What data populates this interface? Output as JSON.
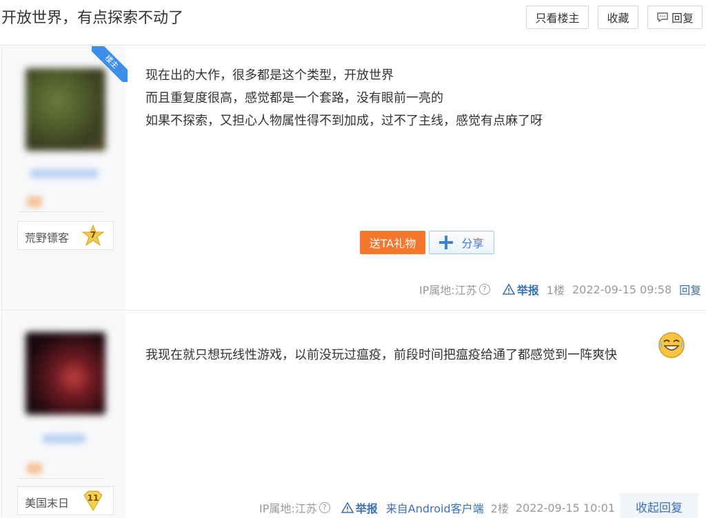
{
  "header": {
    "title": "开放世界，有点探索不动了",
    "btn_only_op": "只看楼主",
    "btn_favorite": "收藏",
    "btn_reply": "回复"
  },
  "posts": [
    {
      "author_level_name": "荒野镖客",
      "level": "7",
      "op_badge": "楼主",
      "lines": [
        "现在出的大作，很多都是这个类型，开放世界",
        "而且重复度很高，感觉都是一个套路，没有眼前一亮的",
        "如果不探索，又担心人物属性得不到加成，过不了主线，感觉有点麻了呀"
      ],
      "gift_label": "送TA礼物",
      "share_label": "分享",
      "ip": "IP属地:江苏",
      "help": "?",
      "report": "举报",
      "floor": "1楼",
      "time": "2022-09-15 09:58",
      "reply": "回复"
    },
    {
      "author_level_name": "美国末日",
      "level": "11",
      "text": "我现在就只想玩线性游戏，以前没玩过瘟疫，前段时间把瘟疫给通了都感觉到一阵爽快",
      "emoji": "crying-laugh-emoji",
      "ip": "IP属地:江苏",
      "help": "?",
      "report": "举报",
      "source": "来自Android客户端",
      "floor": "2楼",
      "time": "2022-09-15 10:01",
      "collapse": "收起回复"
    }
  ]
}
